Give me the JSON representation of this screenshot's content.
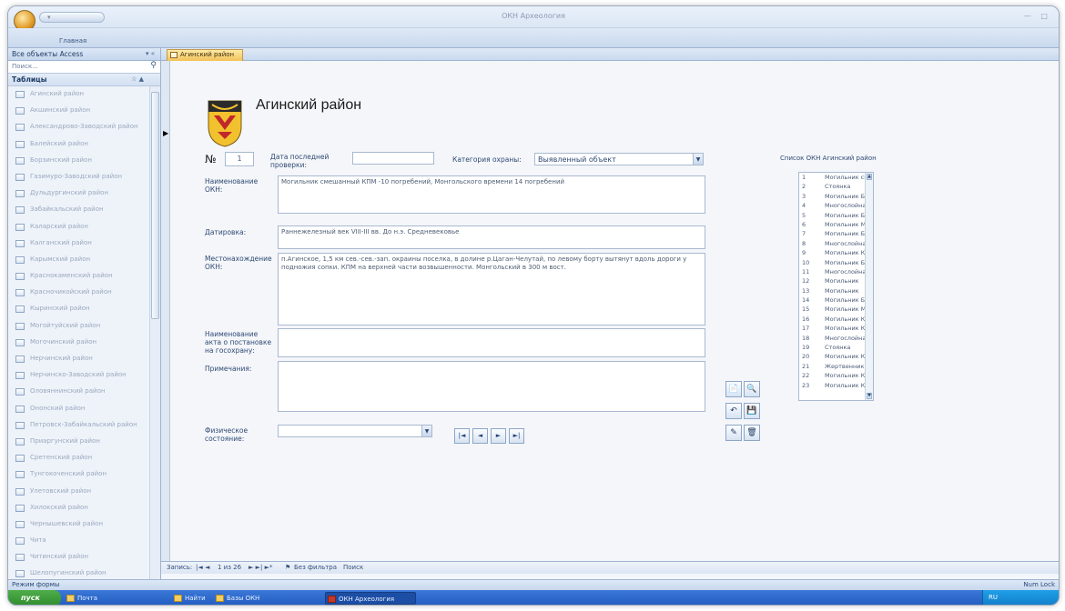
{
  "window": {
    "app_title": "ОКН Археология",
    "controls": "— □",
    "qat_label": "Главная"
  },
  "ribbon": {
    "tab_home": "Главная"
  },
  "nav_pane": {
    "header": "Все объекты Access",
    "search_placeholder": "Поиск...",
    "group": "Таблицы",
    "items": [
      "Агинский район",
      "Акшинский район",
      "Александрово-Заводский район",
      "Балейский район",
      "Борзинский район",
      "Газимуро-Заводский район",
      "Дульдургинский район",
      "Забайкальский район",
      "Каларский район",
      "Калганский район",
      "Карымский район",
      "Краснокаменский район",
      "Красночикойский район",
      "Кыринский район",
      "Могойтуйский район",
      "Могочинский район",
      "Нерчинский район",
      "Нерчинско-Заводский район",
      "Оловяннинский район",
      "Ононский район",
      "Петровск-Забайкальский район",
      "Приаргунский район",
      "Сретенский район",
      "Тунгокоченский район",
      "Улетовский район",
      "Хилокский район",
      "Чернышевский район",
      "Чита",
      "Читинский район",
      "Шелопугинский район"
    ]
  },
  "document_tab": {
    "label": "Агинский район"
  },
  "form": {
    "title": "Агинский район",
    "number_label": "№",
    "number_value": "1",
    "last_check_label": "Дата последней проверки:",
    "last_check_value": "",
    "category_label": "Категория охраны:",
    "category_value": "Выявленный объект",
    "name_label": "Наименование ОКН:",
    "name_value": "Могильник смешанный КПМ -10 погребений, Монгольского времени 14 погребений",
    "dating_label": "Датировка:",
    "dating_value": "Раннежелезный век VIII-III вв. До н.э. Средневековье",
    "location_label": "Местонахождение ОКН:",
    "location_value": "п.Агинское, 1,5 км сев.-сев.-зап. окраины поселка, в долине р.Цаган-Челутай, по левому борту вытянут вдоль дороги у подножия сопки. КПМ на верхней части возвышенности. Монгольский в 300 м вост.",
    "act_label": "Наименование акта о постановке на госохрану:",
    "act_value": "",
    "notes_label": "Примечания:",
    "notes_value": "",
    "condition_label": "Физическое состояние:",
    "condition_value": "",
    "okn_list_title": "Список ОКН Агинский район",
    "okn_list": [
      {
        "n": "1",
        "v": "Могильник смешанный"
      },
      {
        "n": "2",
        "v": "Стоянка"
      },
      {
        "n": "3",
        "v": "Могильник Буриатуйск"
      },
      {
        "n": "4",
        "v": "Многослойная стоянк"
      },
      {
        "n": "5",
        "v": "Могильник Буриатуйск"
      },
      {
        "n": "6",
        "v": "Могильник Монгольск"
      },
      {
        "n": "7",
        "v": "Могильник Буриатуйск"
      },
      {
        "n": "8",
        "v": "Многослойная стоянк"
      },
      {
        "n": "9",
        "v": "Могильник КПМ, 16 по"
      },
      {
        "n": "10",
        "v": "Могильник Буриатуйск"
      },
      {
        "n": "11",
        "v": "Многослойная стоянк"
      },
      {
        "n": "12",
        "v": "Могильник"
      },
      {
        "n": "13",
        "v": "Могильник"
      },
      {
        "n": "14",
        "v": "Могильник Буриатуйск"
      },
      {
        "n": "15",
        "v": "Могильник Монгольск"
      },
      {
        "n": "16",
        "v": "Могильник КПМ 26 пог"
      },
      {
        "n": "17",
        "v": "Могильник КПМ 16 пог"
      },
      {
        "n": "18",
        "v": "Многослойная стоянк"
      },
      {
        "n": "19",
        "v": "Стоянка"
      },
      {
        "n": "20",
        "v": "Могильник КПМ 270 п"
      },
      {
        "n": "21",
        "v": "Жертвенник"
      },
      {
        "n": "22",
        "v": "Могильник КПМ 12 пог"
      },
      {
        "n": "23",
        "v": "Могильник КПМ 24 пог"
      }
    ],
    "nav_buttons": {
      "first": "|◄",
      "prev": "◄",
      "next": "►",
      "last": "►|"
    },
    "tool_icons": [
      "new-record-icon",
      "find-icon",
      "undo-icon",
      "save-icon",
      "edit-icon",
      "delete-icon"
    ]
  },
  "record_nav": {
    "label": "Запись:",
    "position": "1 из 26",
    "filter": "Без фильтра",
    "search": "Поиск"
  },
  "status_bar": {
    "mode": "Режим формы",
    "num_lock": "Num Lock"
  },
  "taskbar": {
    "start": "пуск",
    "tasks": [
      "Почта",
      "Найти",
      "Базы ОКН",
      "ОКН Археология"
    ],
    "tray_lang": "RU"
  }
}
